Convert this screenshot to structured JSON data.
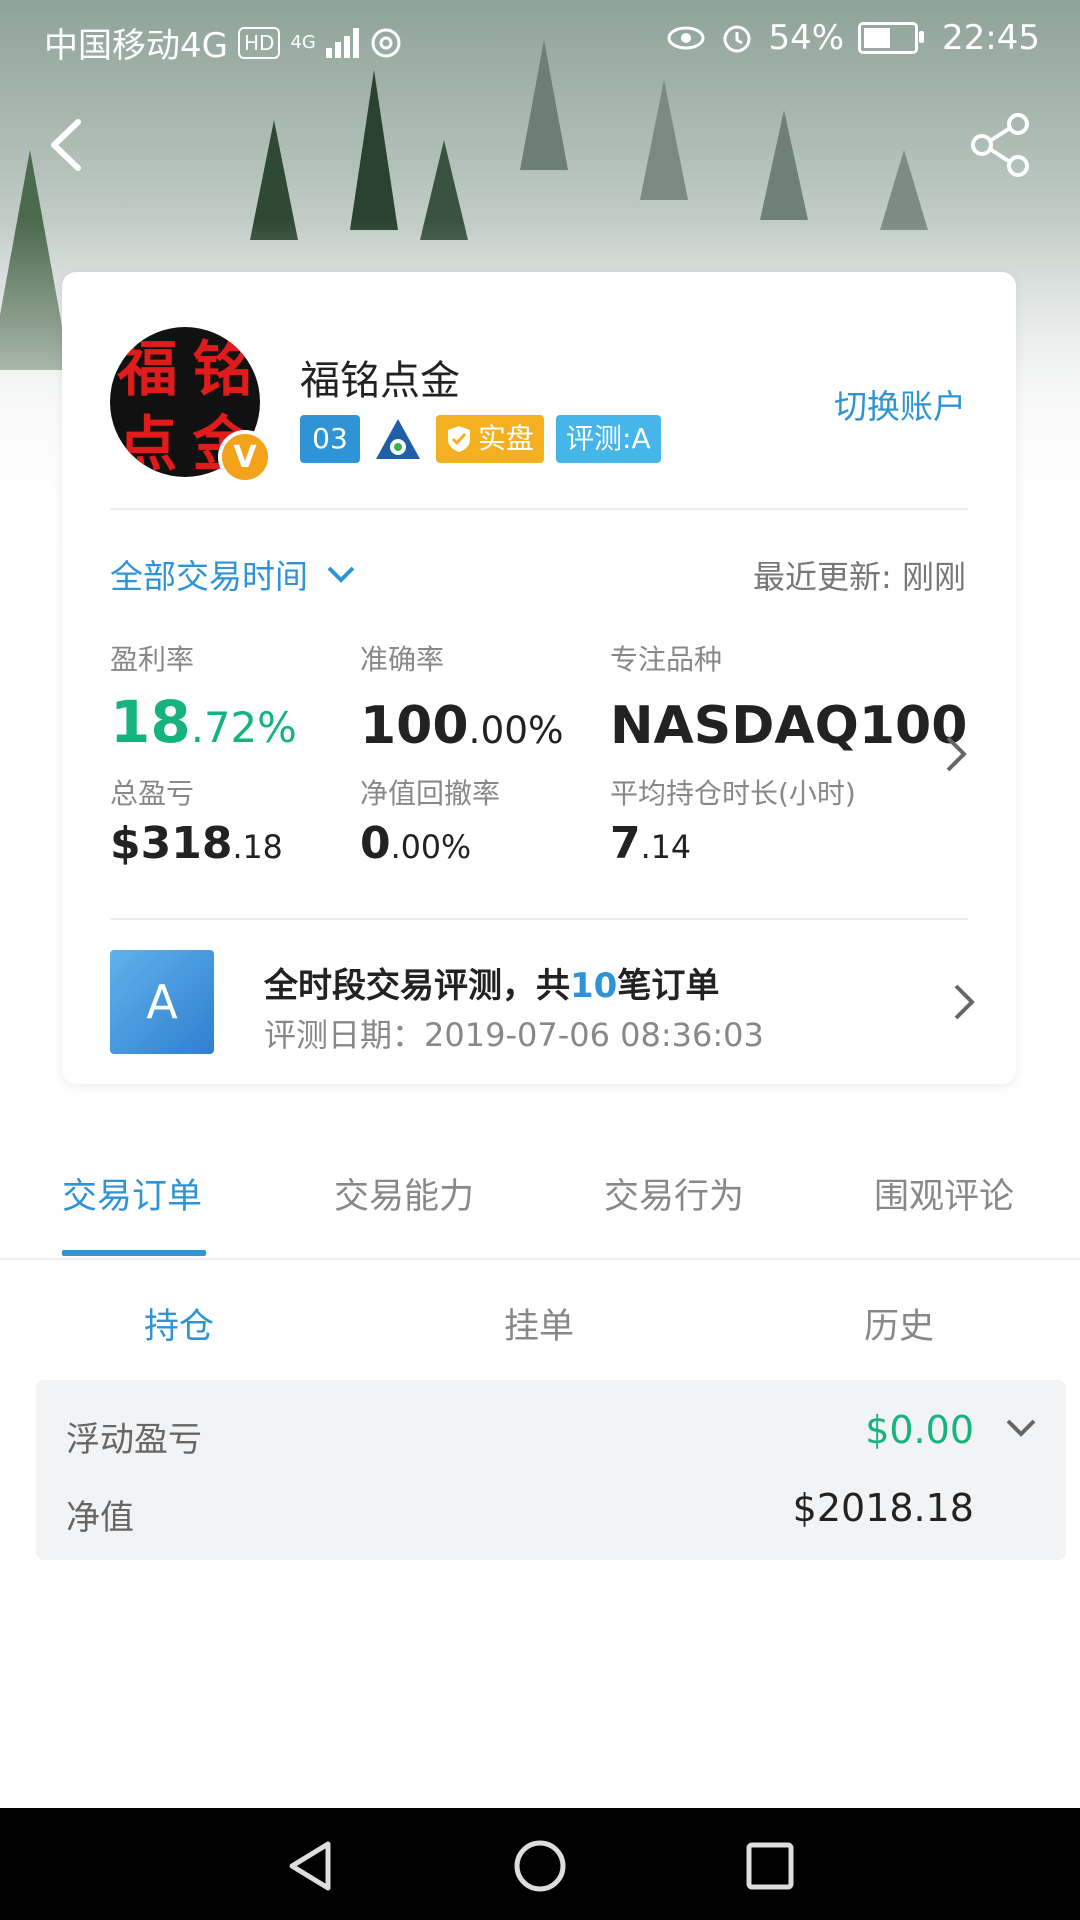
{
  "status_bar": {
    "carrier": "中国移动4G",
    "hd": "HD",
    "network": "4G",
    "battery": "54%",
    "time": "22:45"
  },
  "profile": {
    "avatar_chars": [
      "福",
      "铭",
      "点",
      "金"
    ],
    "verified": "V",
    "name": "福铭点金",
    "tag_level": "03",
    "tag_real": "实盘",
    "tag_eval": "评测:A",
    "switch_account": "切换账户"
  },
  "filter": {
    "period": "全部交易时间",
    "last_update": "最近更新: 刚刚"
  },
  "stats": {
    "profit_rate": {
      "label": "盈利率",
      "int": "18",
      "dec": ".72%"
    },
    "accuracy": {
      "label": "准确率",
      "int": "100",
      "dec": ".00%"
    },
    "focus": {
      "label": "专注品种",
      "value": "NASDAQ100"
    },
    "total_pnl": {
      "label": "总盈亏",
      "int": "$318",
      "dec": ".18"
    },
    "drawdown": {
      "label": "净值回撤率",
      "int": "0",
      "dec": ".00%"
    },
    "avg_hold": {
      "label": "平均持仓时长(小时)",
      "int": "7",
      "dec": ".14"
    }
  },
  "evaluation": {
    "grade": "A",
    "title_prefix": "全时段交易评测，共",
    "count": "10",
    "title_suffix": "笔订单",
    "date": "评测日期：2019-07-06 08:36:03"
  },
  "tabs": [
    "交易订单",
    "交易能力",
    "交易行为",
    "围观评论"
  ],
  "subtabs": [
    "持仓",
    "挂单",
    "历史"
  ],
  "summary": {
    "floating_label": "浮动盈亏",
    "floating_value": "$0.00",
    "equity_label": "净值",
    "equity_value": "$2018.18"
  },
  "colors": {
    "accent": "#2f94d6",
    "profit": "#16b37d",
    "real_tag": "#f4b020",
    "verify": "#f3a31b"
  }
}
